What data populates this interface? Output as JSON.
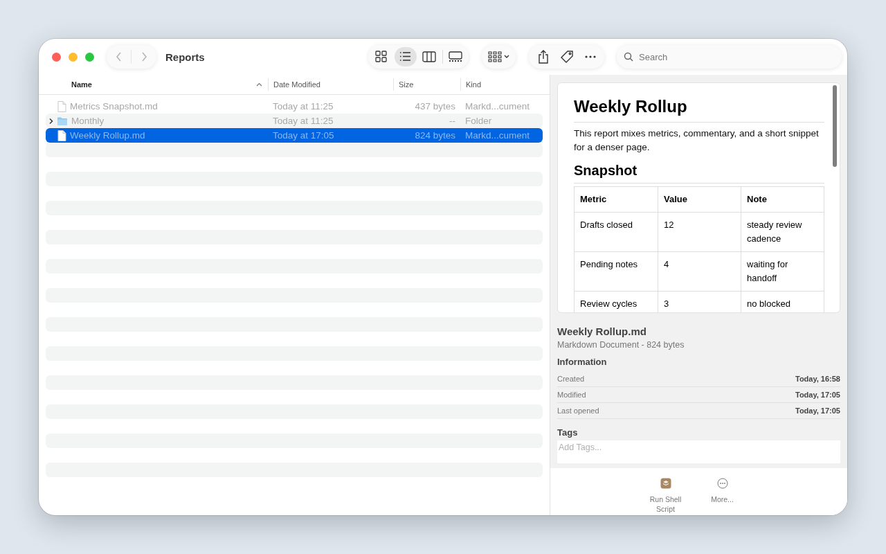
{
  "window": {
    "title": "Reports"
  },
  "toolbar": {
    "views": [
      {
        "kind": "icons",
        "selected": false
      },
      {
        "kind": "list",
        "selected": true
      },
      {
        "kind": "columns",
        "selected": false
      },
      {
        "kind": "gallery",
        "selected": false
      }
    ],
    "search": {
      "placeholder": "Search"
    }
  },
  "table": {
    "columns": [
      {
        "label": "Name",
        "sorted": true
      },
      {
        "label": "Date Modified",
        "sorted": false
      },
      {
        "label": "Size",
        "sorted": false
      },
      {
        "label": "Kind",
        "sorted": false
      }
    ],
    "rows": [
      {
        "kind": "file",
        "name": "Metrics Snapshot.md",
        "date": "Today at 11:25",
        "size": "437 bytes",
        "type": "Markd...cument",
        "dimmed": true,
        "selected": false
      },
      {
        "kind": "folder",
        "name": "Monthly",
        "date": "Today at 11:25",
        "size": "--",
        "type": "Folder",
        "dimmed": true,
        "selected": false,
        "expanded": false
      },
      {
        "kind": "file",
        "name": "Weekly Rollup.md",
        "date": "Today at 17:05",
        "size": "824 bytes",
        "type": "Markd...cument",
        "dimmed": false,
        "selected": true
      }
    ]
  },
  "preview": {
    "title": "Weekly Rollup",
    "intro": "This report mixes metrics, commentary, and a short snippet for a denser page.",
    "section": "Snapshot",
    "table": {
      "columns": [
        "Metric",
        "Value",
        "Note"
      ],
      "rows": [
        [
          "Drafts closed",
          "12",
          "steady review cadence"
        ],
        [
          "Pending notes",
          "4",
          "waiting for handoff"
        ],
        [
          "Review cycles",
          "3",
          "no blocked"
        ]
      ]
    }
  },
  "info": {
    "filename": "Weekly Rollup.md",
    "subtitle": "Markdown Document - 824 bytes",
    "heading": "Information",
    "fields": [
      {
        "label": "Created",
        "value": "Today, 16:58"
      },
      {
        "label": "Modified",
        "value": "Today, 17:05"
      },
      {
        "label": "Last opened",
        "value": "Today, 17:05"
      }
    ],
    "tags_heading": "Tags",
    "tags_placeholder": "Add Tags..."
  },
  "actions": [
    {
      "kind": "script",
      "label": "Run Shell Script"
    },
    {
      "kind": "more",
      "label": "More..."
    }
  ]
}
